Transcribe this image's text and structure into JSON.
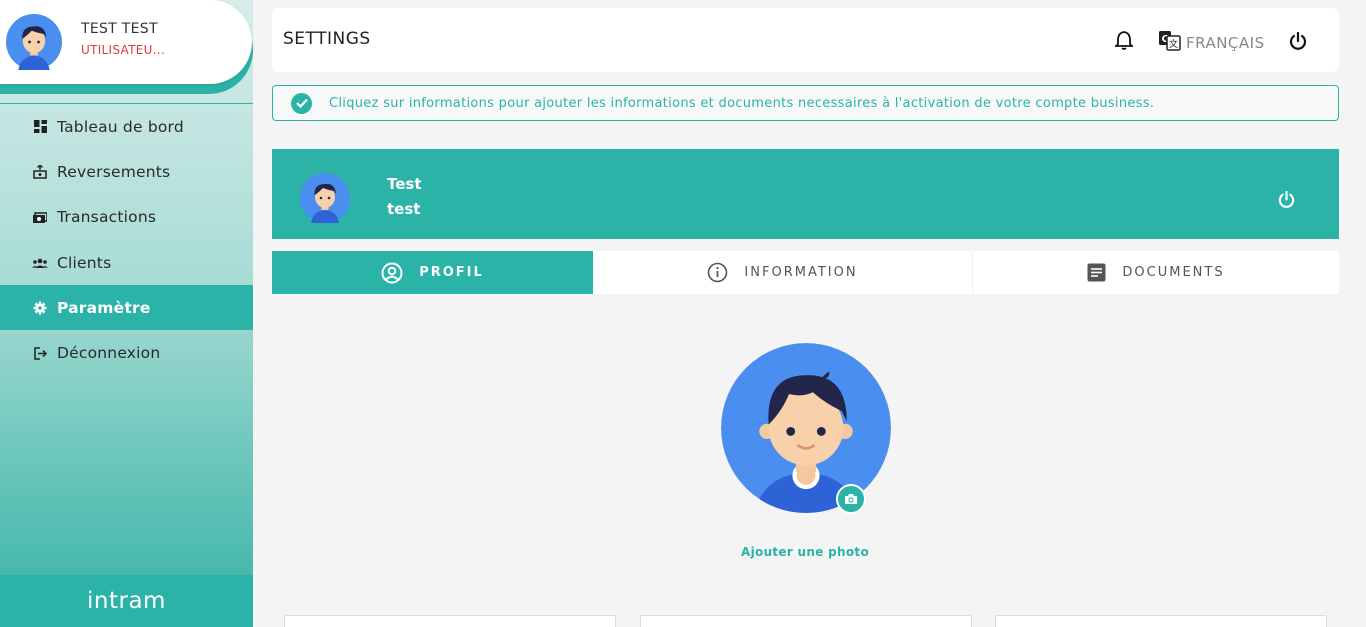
{
  "user": {
    "name": "TEST TEST",
    "role": "UTILISATEU..."
  },
  "sidebar": {
    "items": [
      {
        "label": "Tableau de bord",
        "icon": "dashboard-icon",
        "active": false
      },
      {
        "label": "Reversements",
        "icon": "payout-icon",
        "active": false
      },
      {
        "label": "Transactions",
        "icon": "money-icon",
        "active": false
      },
      {
        "label": "Clients",
        "icon": "users-icon",
        "active": false
      },
      {
        "label": "Paramètre",
        "icon": "gear-icon",
        "active": true
      },
      {
        "label": "Déconnexion",
        "icon": "logout-icon",
        "active": false
      }
    ],
    "brand": "intram"
  },
  "header": {
    "title": "SETTINGS",
    "language": "FRANÇAIS"
  },
  "alert": {
    "message": "Cliquez sur informations pour ajouter les informations et documents necessaires à l'activation de votre compte business."
  },
  "profile": {
    "first_name": "Test",
    "last_name": "test"
  },
  "tabs": [
    {
      "label": "PROFIL",
      "icon": "account-circle-icon",
      "active": true
    },
    {
      "label": "INFORMATION",
      "icon": "info-icon",
      "active": false
    },
    {
      "label": "DOCUMENTS",
      "icon": "document-icon",
      "active": false
    }
  ],
  "photo": {
    "add_label": "Ajouter une photo"
  },
  "colors": {
    "accent": "#2cb3a8",
    "role_text": "#e03b3b",
    "avatar_bg": "#4a8ff0"
  }
}
